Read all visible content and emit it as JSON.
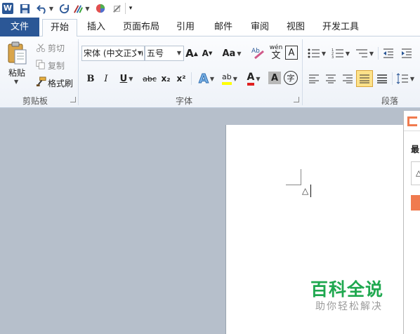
{
  "qat": {
    "word_icon": "W",
    "save_icon": "save-icon",
    "undo_icon": "undo-icon",
    "redo_icon": "redo-icon"
  },
  "tabs": [
    {
      "label": "文件"
    },
    {
      "label": "开始"
    },
    {
      "label": "插入"
    },
    {
      "label": "页面布局"
    },
    {
      "label": "引用"
    },
    {
      "label": "邮件"
    },
    {
      "label": "审阅"
    },
    {
      "label": "视图"
    },
    {
      "label": "开发工具"
    }
  ],
  "clipboard": {
    "paste": "粘贴",
    "cut": "剪切",
    "copy": "复制",
    "format_painter": "格式刷",
    "group_label": "剪贴板"
  },
  "font": {
    "font_name": "宋体 (中文正文)",
    "font_size": "五号",
    "grow": "A",
    "shrink": "A",
    "change_case": "Aa",
    "bold": "B",
    "italic": "I",
    "underline": "U",
    "strike": "abc",
    "subscript": "x₂",
    "superscript": "x²",
    "text_effects": "A",
    "highlight": "ab",
    "font_color": "A",
    "char_shading": "A",
    "enclose": "字",
    "phonetic": "wén",
    "char_border": "A",
    "group_label": "字体"
  },
  "paragraph": {
    "group_label": "段落"
  },
  "document": {
    "cursor_char": "△"
  },
  "sidepanel": {
    "heading_char": "最",
    "input_char": "△"
  },
  "watermark": {
    "title": "百科全说",
    "subtitle": "助你轻松解决"
  },
  "colors": {
    "file_tab": "#2b5796",
    "highlight_yellow": "#ffff00",
    "font_red": "#e02020",
    "watermark_green": "#1fa84f",
    "panel_orange": "#f07b4f"
  }
}
